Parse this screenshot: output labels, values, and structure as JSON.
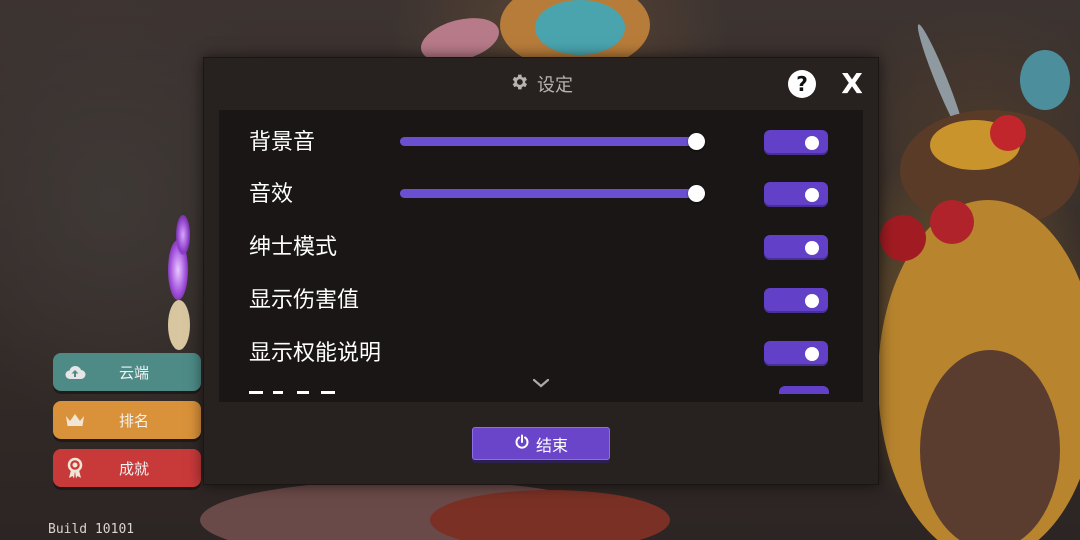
{
  "dialog": {
    "title": "设定",
    "help_label": "?",
    "close_label": "X",
    "end_button": "结束"
  },
  "settings": {
    "bgm": {
      "label": "背景音",
      "level": 1.0,
      "enabled": true
    },
    "sfx": {
      "label": "音效",
      "level": 1.0,
      "enabled": true
    },
    "gentleman_mode": {
      "label": "绅士模式",
      "enabled": true
    },
    "show_damage": {
      "label": "显示伤害值",
      "enabled": true
    },
    "show_perk_desc": {
      "label": "显示权能说明",
      "enabled": true
    }
  },
  "side_menu": {
    "cloud": "云端",
    "ranking": "排名",
    "achievements": "成就"
  },
  "build": "Build 10101",
  "colors": {
    "accent": "#6241c8",
    "cloud": "#4e8a86",
    "ranking": "#d9913a",
    "achievements": "#c8393a"
  }
}
